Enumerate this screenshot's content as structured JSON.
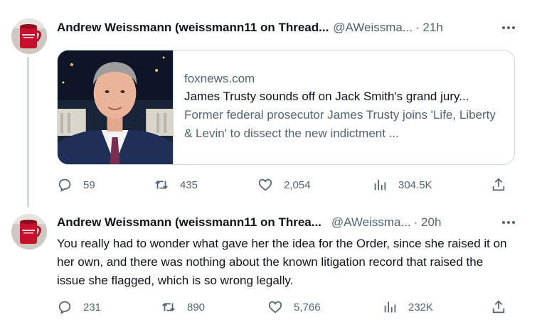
{
  "tweets": [
    {
      "author_name": "Andrew Weissmann (weissmann11 on Thread...",
      "handle": "@AWeissma...",
      "time": "· 21h",
      "avatar_icon": "red-mug-avatar",
      "card": {
        "domain": "foxnews.com",
        "title": "James Trusty sounds off on Jack Smith's grand jury...",
        "description": "Former federal prosecutor James Trusty joins 'Life, Liberty & Levin' to dissect the new indictment ..."
      },
      "actions": {
        "replies": "59",
        "reposts": "435",
        "likes": "2,054",
        "views": "304.5K"
      }
    },
    {
      "author_name": "Andrew Weissmann (weissmann11 on Threa...",
      "handle": "@AWeissma...",
      "time": "· 20h",
      "avatar_icon": "red-mug-avatar",
      "text": "You really had to wonder what gave her the idea for the Order, since she raised it on her own, and there was nothing about the known litigation record that raised the issue she flagged, which is so wrong legally.",
      "actions": {
        "replies": "231",
        "reposts": "890",
        "likes": "5,766",
        "views": "232K"
      }
    }
  ],
  "colors": {
    "text": "#0f1419",
    "secondary": "#536471",
    "border": "#cfd9de",
    "mug": "#c8102e"
  }
}
